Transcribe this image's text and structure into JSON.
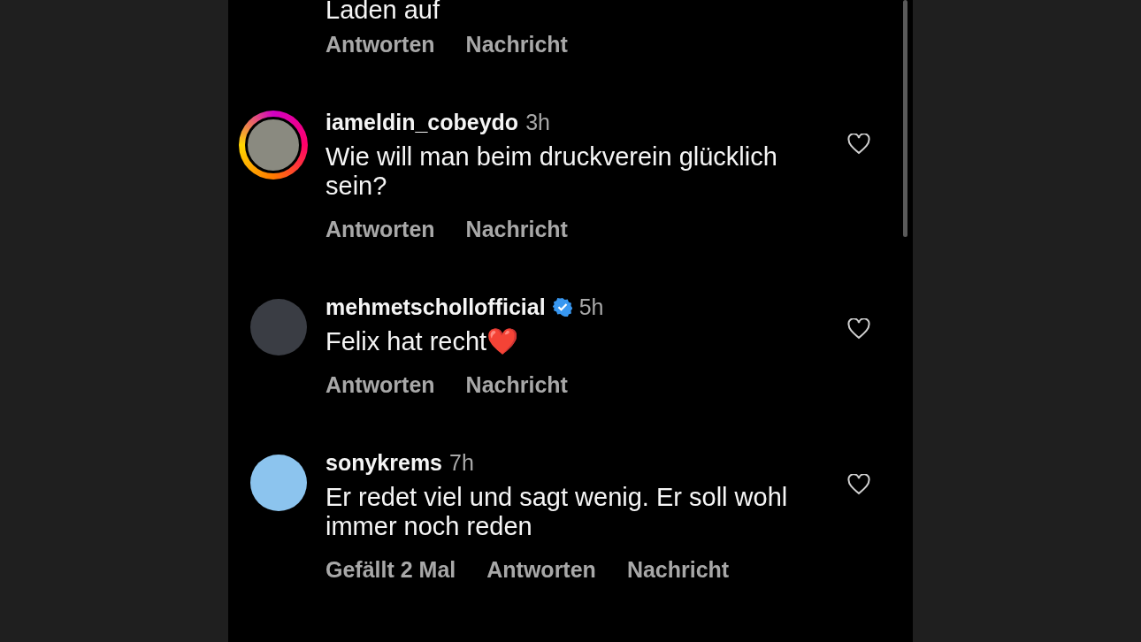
{
  "partial_comment": {
    "text": "Laden auf",
    "actions": [
      {
        "label": "Antworten"
      },
      {
        "label": "Nachricht"
      }
    ]
  },
  "comments": [
    {
      "username": "iameldin_cobeydo",
      "verified": false,
      "story_ring": true,
      "time": "3h",
      "text": "Wie will man beim druckverein glücklich sein?",
      "liked": false,
      "actions": [
        {
          "label": "Antworten"
        },
        {
          "label": "Nachricht"
        }
      ]
    },
    {
      "username": "mehmetschollofficial",
      "verified": true,
      "story_ring": false,
      "time": "5h",
      "text": "Felix hat recht❤️",
      "liked": false,
      "actions": [
        {
          "label": "Antworten"
        },
        {
          "label": "Nachricht"
        }
      ]
    },
    {
      "username": "sonykrems",
      "verified": false,
      "story_ring": false,
      "time": "7h",
      "text": "Er redet viel und sagt wenig. Er soll wohl immer noch reden",
      "liked": false,
      "actions": [
        {
          "label": "Gefällt 2 Mal"
        },
        {
          "label": "Antworten"
        },
        {
          "label": "Nachricht"
        }
      ]
    }
  ]
}
